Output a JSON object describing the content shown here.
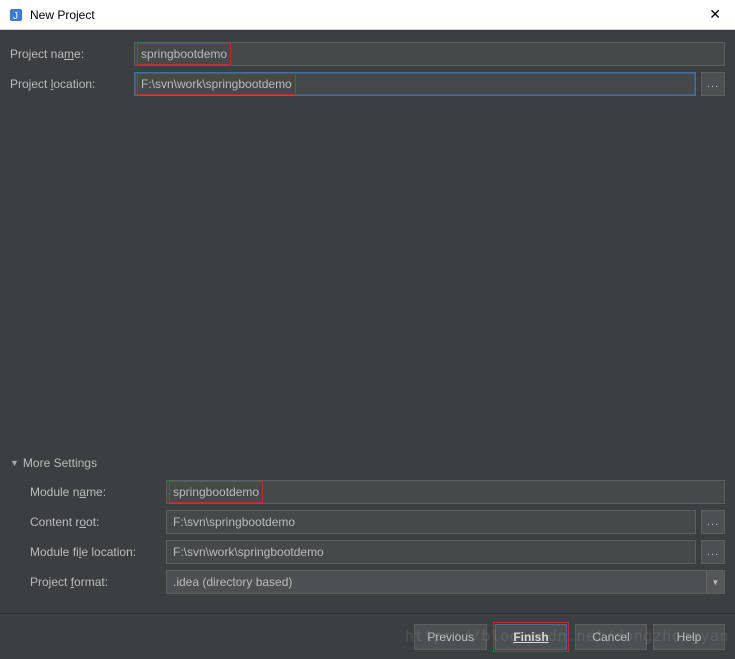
{
  "window": {
    "title": "New Project"
  },
  "fields": {
    "projectNameLabel": "Project name:",
    "projectNameValue": "springbootdemo",
    "projectLocationLabel": "Project location:",
    "projectLocationValue": "F:\\svn\\work\\springbootdemo"
  },
  "more": {
    "header": "More Settings",
    "moduleNameLabel": "Module name:",
    "moduleNameValue": "springbootdemo",
    "contentRootLabel": "Content root:",
    "contentRootValue": "F:\\svn\\springbootdemo",
    "moduleFileLabel": "Module file location:",
    "moduleFileValue": "F:\\svn\\work\\springbootdemo",
    "projectFormatLabel": "Project format:",
    "projectFormatValue": ".idea (directory based)"
  },
  "buttons": {
    "previous": "Previous",
    "finish": "Finish",
    "cancel": "Cancel",
    "help": "Help"
  },
  "browseLabel": "...",
  "watermark": "https://blog.csdn.net/dongzhongyan"
}
